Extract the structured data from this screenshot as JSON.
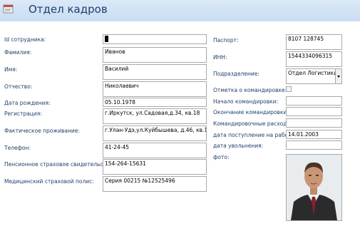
{
  "window": {
    "title": "Отдел кадров",
    "icon": "form-icon"
  },
  "left_form": [
    {
      "label": "Id сотрудника:",
      "value": ""
    },
    {
      "label": "Фамилия:",
      "value": "Иванов"
    },
    {
      "label": "Имя:",
      "value": "Василий"
    },
    {
      "label": "Отчество:",
      "value": "Николаевич"
    },
    {
      "label": "Дата рождения:",
      "value": "05.10.1978"
    },
    {
      "label": "Регистрация:",
      "value": "г.Иркутск, ул.Садовая,д.34, кв.18"
    },
    {
      "label": "Фактическое проживание:",
      "value": "г.Улан-Удэ,ул.Куйбышева, д.46, кв.10"
    },
    {
      "label": "Телефон:",
      "value": "41-24-45"
    },
    {
      "label": "Пенсионное страховое свидетельство:",
      "value": "154-264-15631"
    },
    {
      "label": "Медицинский страховой полис:",
      "value": "Серия 00215 №12525496"
    }
  ],
  "right_form": {
    "passport": {
      "label": "Паспорт:",
      "value": "8107 128745"
    },
    "inn": {
      "label": "ИНН:",
      "value": "1544334096315"
    },
    "department": {
      "label": "Подразделение:",
      "value": "Отдел Логистики"
    },
    "business_trip_flag": {
      "label": "Отметка о командировке:",
      "checked": false
    },
    "trip_start": {
      "label": "Начало командировки:",
      "value": ""
    },
    "trip_end": {
      "label": "Окончание командировки:",
      "value": ""
    },
    "trip_expenses": {
      "label": "Командировочные расходы:",
      "value": ""
    },
    "hire_date": {
      "label": "дата поступление на работу:",
      "value": "14.01.2003"
    },
    "dismissal_date": {
      "label": "дата увольнения:",
      "value": ""
    },
    "photo": {
      "label": "фото:"
    }
  }
}
